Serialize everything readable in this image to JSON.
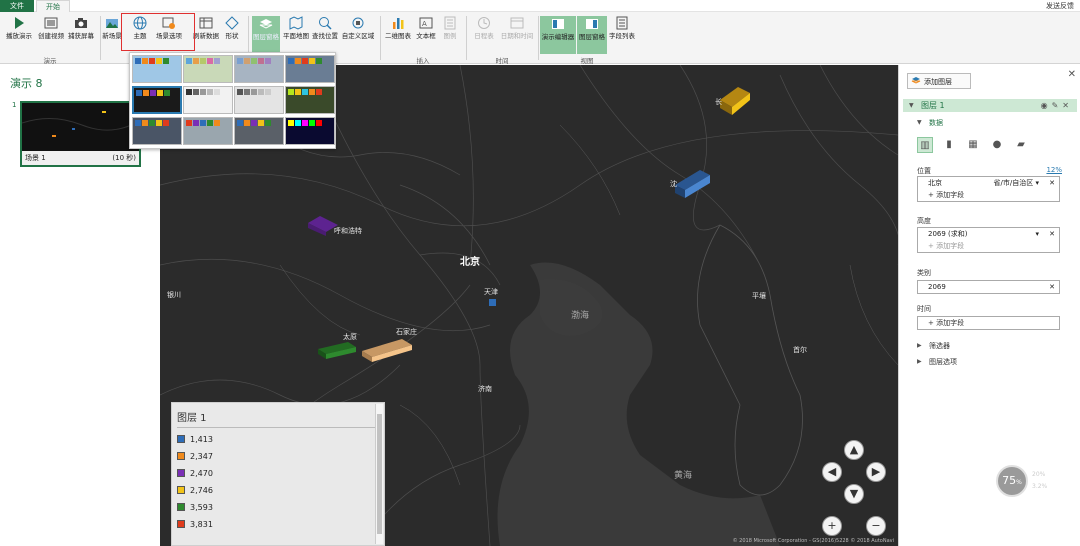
{
  "tabs": {
    "file": "文件",
    "home": "开始"
  },
  "feedback": "发送反馈",
  "ribbon": {
    "play_tour": "播放演示",
    "create_video": "创建视频",
    "capture_screen": "捕获屏幕",
    "new_scene": "新场景",
    "theme": "主题",
    "scene_options": "场景选项",
    "refresh_data": "刷新数据",
    "shapes": "形状",
    "layer_pane": "图层窗格",
    "flat_map": "平面地图",
    "find_location": "查找位置",
    "custom_regions": "自定义区域",
    "chart_2d": "二维图表",
    "text_box": "文本框",
    "legend": "图例",
    "timeline": "日程表",
    "date_time": "日期和时间",
    "tour_editor": "演示编辑器",
    "layer_pane_view": "图层窗格",
    "field_list": "字段列表",
    "groups": {
      "tour": "演示",
      "insert": "插入",
      "time": "时间",
      "view": "视图"
    }
  },
  "left_pane": {
    "title": "演示 8",
    "scene_number": "1",
    "scene_label": "场景 1",
    "scene_duration": "(10 秒)"
  },
  "map": {
    "cities": [
      {
        "id": "beijing",
        "label": "北京"
      },
      {
        "id": "tianjin",
        "label": "天津"
      },
      {
        "id": "shijiazhuang",
        "label": "石家庄"
      },
      {
        "id": "taiyuan",
        "label": "太原"
      },
      {
        "id": "hohhot",
        "label": "呼和浩特"
      },
      {
        "id": "jinan",
        "label": "济南"
      },
      {
        "id": "shenyang",
        "label": "沈"
      },
      {
        "id": "changchun",
        "label": "长"
      },
      {
        "id": "pyongyang",
        "label": "平壤"
      },
      {
        "id": "seoul",
        "label": "首尔"
      },
      {
        "id": "yinchuan",
        "label": "银川"
      }
    ],
    "seas": {
      "bohai": "渤海",
      "yellow": "黄海"
    },
    "copyright": "© 2018 Microsoft Corporation - GS(2016)5228  © 2018 AutoNavi"
  },
  "legend": {
    "title": "图层 1",
    "items": [
      {
        "value": "1,413",
        "color": "#2e6db8"
      },
      {
        "value": "2,347",
        "color": "#f08a1c"
      },
      {
        "value": "2,470",
        "color": "#7a2fb5"
      },
      {
        "value": "2,746",
        "color": "#f2c318"
      },
      {
        "value": "3,593",
        "color": "#2e8a2e"
      },
      {
        "value": "3,831",
        "color": "#e03b1c"
      }
    ]
  },
  "right_pane": {
    "add_layer": "添加图层",
    "layer_name": "图层 1",
    "data_section": "数据",
    "location_label": "位置",
    "location_pct": "12%",
    "location_field": "北京",
    "location_type": "省/市/自治区",
    "add_field": "添加字段",
    "height_label": "高度",
    "height_field": "2069 (求和)",
    "category_label": "类别",
    "category_field": "2069",
    "time_label": "时间",
    "filters": "筛选器",
    "layer_options": "图层选项"
  },
  "tour_widget": {
    "percent": "75",
    "unit": "%",
    "line1": "20%",
    "line2": "3.2%"
  },
  "colors": {
    "accent": "#217346",
    "map_bg": "#2a2a2a"
  }
}
